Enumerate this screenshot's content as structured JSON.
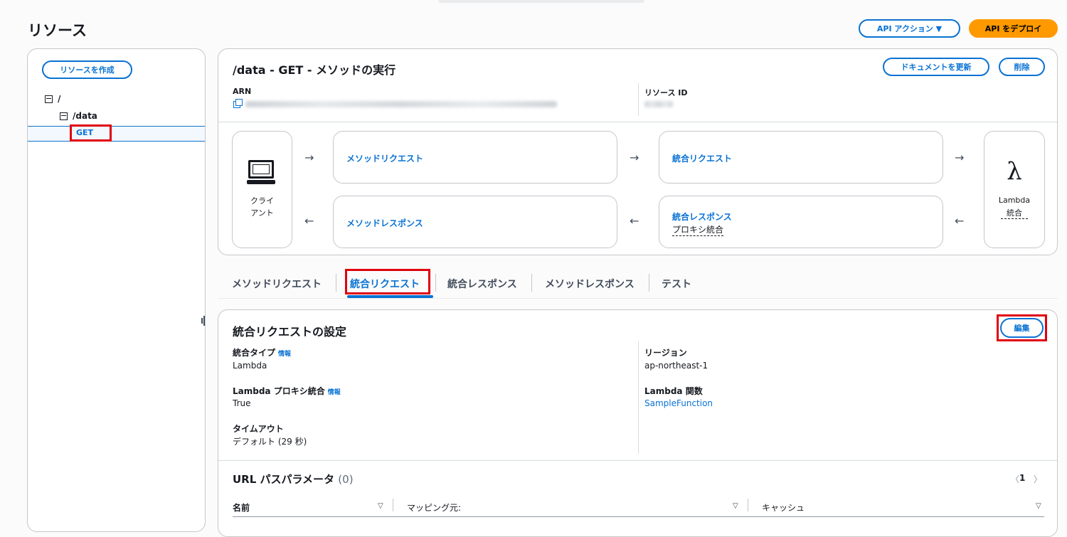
{
  "header": {
    "title": "リソース",
    "api_actions_label": "API アクション ▼",
    "deploy_label": "API をデプロイ"
  },
  "sidebar": {
    "create_label": "リソースを作成",
    "root": "/",
    "data": "/data",
    "get": "GET"
  },
  "method": {
    "title": "/data - GET - メソッドの実行",
    "update_docs_label": "ドキュメントを更新",
    "delete_label": "削除",
    "arn_label": "ARN",
    "resource_id_label": "リソース ID",
    "client_label_1": "クライ",
    "client_label_2": "アント",
    "method_request": "メソッドリクエスト",
    "method_response": "メソッドレスポンス",
    "integration_request": "統合リクエスト",
    "integration_response": "統合レスポンス",
    "integration_response_sub": "プロキシ統合",
    "lambda_symbol": "λ",
    "lambda_label": "Lambda",
    "lambda_sub": "統合",
    "arrow_right": "→",
    "arrow_left": "←"
  },
  "tabs": [
    {
      "label": "メソッドリクエスト"
    },
    {
      "label": "統合リクエスト"
    },
    {
      "label": "統合レスポンス"
    },
    {
      "label": "メソッドレスポンス"
    },
    {
      "label": "テスト"
    }
  ],
  "settings": {
    "title": "統合リクエストの設定",
    "edit_label": "編集",
    "info_label": "情報",
    "integration_type_label": "統合タイプ",
    "integration_type_value": "Lambda",
    "proxy_label": "Lambda プロキシ統合",
    "proxy_value": "True",
    "timeout_label": "タイムアウト",
    "timeout_value": "デフォルト (29 秒)",
    "region_label": "リージョン",
    "region_value": "ap-northeast-1",
    "function_label": "Lambda 関数",
    "function_value": "SampleFunction",
    "params_title": "URL パスパラメータ",
    "params_count": "(0)",
    "page_prev": "〈",
    "page_number": "1",
    "page_next": "〉",
    "columns": [
      "名前",
      "マッピング元:",
      "キャッシュ"
    ],
    "sort_icon": "▽"
  }
}
